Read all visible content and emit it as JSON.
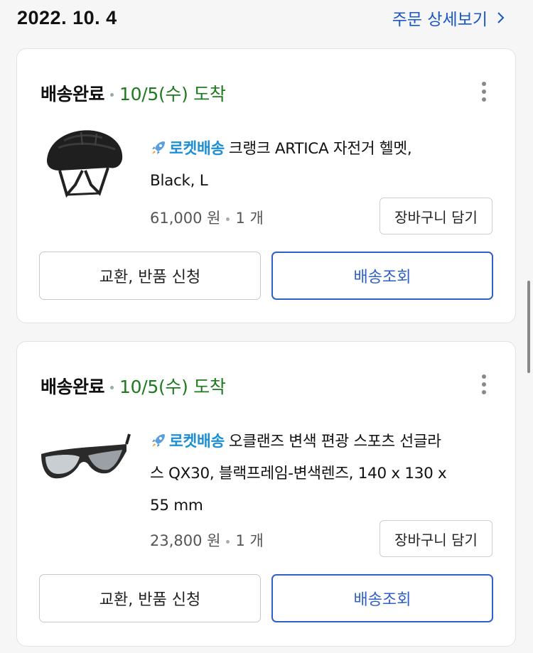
{
  "order": {
    "date": "2022. 10. 4",
    "detail_link": "주문 상세보기"
  },
  "items": [
    {
      "status": "배송완료",
      "arrival": "10/5(수) 도착",
      "rocket_label": "로켓배송",
      "title_line1": "크랭크 ARTICA 자전거 헬멧,",
      "title_line2": "Black, L",
      "title_line3": "",
      "price": "61,000 원",
      "quantity": "1 개",
      "cart_button": "장바구니 담기",
      "exchange_button": "교환, 반품 신청",
      "tracking_button": "배송조회",
      "image_icon": "bicycle-helmet-image"
    },
    {
      "status": "배송완료",
      "arrival": "10/5(수) 도착",
      "rocket_label": "로켓배송",
      "title_line1": "오클랜즈 변색 편광 스포츠 선글라",
      "title_line2": "스 QX30, 블랙프레임-변색렌즈, 140 x 130 x",
      "title_line3": "55 mm",
      "price": "23,800 원",
      "quantity": "1 개",
      "cart_button": "장바구니 담기",
      "exchange_button": "교환, 반품 신청",
      "tracking_button": "배송조회",
      "image_icon": "sports-sunglasses-image"
    }
  ],
  "colors": {
    "accent_blue": "#2f5fc8",
    "arrival_green": "#1e7a1e",
    "rocket_blue": "#1c8fd6"
  }
}
